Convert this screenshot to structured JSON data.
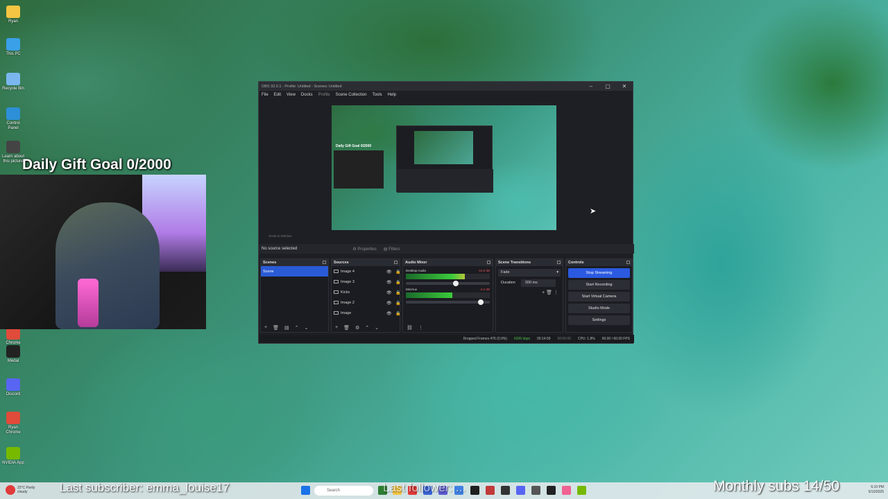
{
  "desktop": {
    "icons": [
      {
        "label": "Ryan",
        "color": "#f4c542"
      },
      {
        "label": "This PC",
        "color": "#3aa0e8"
      },
      {
        "label": "Recycle Bin",
        "color": "#7ab7ef"
      },
      {
        "label": "Control Panel",
        "color": "#2d8fd8"
      },
      {
        "label": "Learn about this picture",
        "color": "#444"
      },
      {
        "label": "Chrome",
        "color": "#e04b3a"
      },
      {
        "label": "Medal",
        "color": "#222"
      },
      {
        "label": "Discord",
        "color": "#5865f2"
      },
      {
        "label": "Ryan Chrome",
        "color": "#e04b3a"
      },
      {
        "label": "NVIDIA App",
        "color": "#76b900"
      }
    ]
  },
  "overlay": {
    "goal": "Daily Gift Goal 0/2000",
    "last_subscriber": "Last subscriber: emma_louise17",
    "last_follower": "Last follower: ...",
    "monthly_subs": "Monthly subs 14/50"
  },
  "obs": {
    "title": "OBS 32.0.1 - Profile: Untitled - Scenes: Untitled",
    "menu": [
      "File",
      "Edit",
      "View",
      "Docks",
      "Profile",
      "Scene Collection",
      "Tools",
      "Help"
    ],
    "preview_mini_goal": "Daily Gift Goal 0/2000",
    "preview_zoom": "Scale to Window",
    "no_source": "No source selected",
    "properties": "Properties",
    "filters": "Filters",
    "scenes": {
      "title": "Scenes",
      "items": [
        "Scene"
      ]
    },
    "sources": {
      "title": "Sources",
      "items": [
        "Image 4",
        "Image 3",
        "Kicks",
        "Image 2",
        "Image"
      ]
    },
    "mixer": {
      "title": "Audio Mixer",
      "channels": [
        {
          "name": "Desktop Audio",
          "db": "-15.0 dB",
          "level": 0.7,
          "fader": 0.6
        },
        {
          "name": "Mic/Aux",
          "db": "-2.2 dB",
          "level": 0.55,
          "fader": 0.9
        }
      ]
    },
    "transitions": {
      "title": "Scene Transitions",
      "type": "Fade",
      "duration_label": "Duration",
      "duration": "300 ms"
    },
    "controls": {
      "title": "Controls",
      "buttons": [
        "Stop Streaming",
        "Start Recording",
        "Start Virtual Camera",
        "Studio Mode",
        "Settings"
      ]
    },
    "status": {
      "dropped": "Dropped Frames 476 (0.9%)",
      "kbps": "6206 kbps",
      "stream_time": "00:14:09",
      "rec_time": "00:00:00",
      "cpu": "CPU: 1.8%",
      "fps": "60.00 / 60.00 FPS"
    }
  },
  "taskbar": {
    "search": "Search",
    "time": "6:10 PM",
    "date": "5/10/2025",
    "weather": "22°C Partly cloudy"
  }
}
